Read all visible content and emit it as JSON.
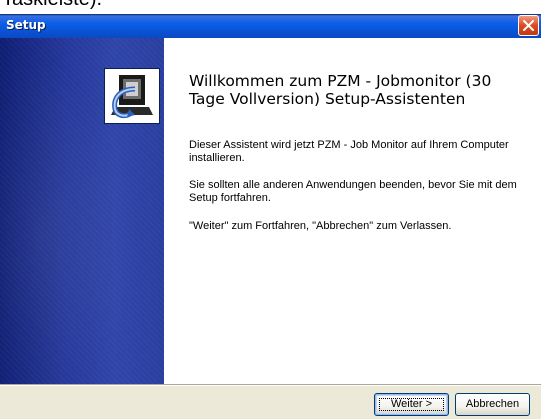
{
  "above_text": "Taskleiste).",
  "window": {
    "title": "Setup",
    "close_icon": "close-icon",
    "colors": {
      "titlebar": "#0a53d6",
      "sidebar": "#25379a",
      "close": "#d94b23"
    }
  },
  "content": {
    "title": "Willkommen zum PZM - Jobmonitor (30 Tage Vollversion) Setup-Assistenten",
    "paragraphs": [
      "Dieser Assistent wird jetzt PZM - Job Monitor auf Ihrem Computer installieren.",
      "Sie sollten alle anderen Anwendungen beenden, bevor Sie mit dem Setup fortfahren.",
      "\"Weiter\" zum Fortfahren, \"Abbrechen\" zum Verlassen."
    ]
  },
  "buttons": {
    "next": "Weiter >",
    "cancel": "Abbrechen"
  }
}
